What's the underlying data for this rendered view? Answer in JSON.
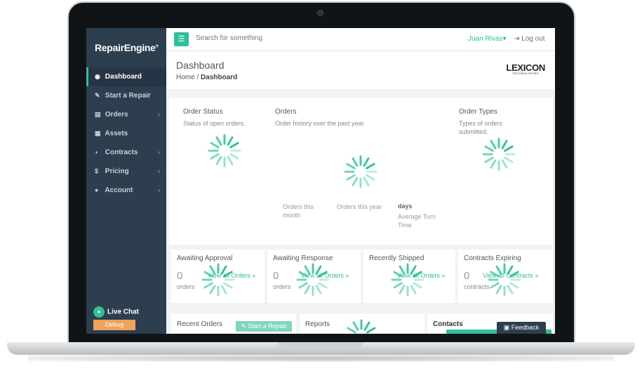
{
  "sidebar": {
    "brand": "RepairEngine",
    "brand_mark": "®",
    "items": [
      {
        "label": "Dashboard",
        "icon": "dashboard-icon",
        "glyph": "◉",
        "chevron": ""
      },
      {
        "label": "Start a Repair",
        "icon": "wrench-icon",
        "glyph": "✎",
        "chevron": ""
      },
      {
        "label": "Orders",
        "icon": "list-icon",
        "glyph": "▤",
        "chevron": "›"
      },
      {
        "label": "Assets",
        "icon": "grid-icon",
        "glyph": "▦",
        "chevron": ""
      },
      {
        "label": "Contracts",
        "icon": "shield-icon",
        "glyph": "◗",
        "chevron": "›"
      },
      {
        "label": "Pricing",
        "icon": "dollar-icon",
        "glyph": "$",
        "chevron": "›"
      },
      {
        "label": "Account",
        "icon": "user-icon",
        "glyph": "●",
        "chevron": "›"
      }
    ],
    "live_chat": "Live Chat",
    "debug": "Debug"
  },
  "topbar": {
    "search_placeholder": "Search for something",
    "user": "Juan Rivas",
    "user_caret": "▾",
    "logout": "Log out"
  },
  "header": {
    "title": "Dashboard",
    "breadcrumb_home": "Home",
    "breadcrumb_sep": "/",
    "breadcrumb_current": "Dashboard",
    "logo": "LEXICON",
    "logo_sub": "TECHNOLOGIES"
  },
  "panel": {
    "order_status": {
      "title": "Order Status",
      "subtitle": "Status of open orders."
    },
    "orders": {
      "title": "Orders",
      "subtitle": "Order history over the past year."
    },
    "order_types": {
      "title": "Order Types",
      "subtitle": "Types of orders submitted."
    },
    "stats": {
      "this_month": "Orders this month",
      "this_year": "Orders this year",
      "turn_value": "days",
      "turn_label": "Average Turn Time"
    }
  },
  "cards": [
    {
      "title": "Awaiting Approval",
      "count": "0",
      "unit": "orders",
      "link": "View all Orders »"
    },
    {
      "title": "Awaiting Response",
      "count": "0",
      "unit": "orders",
      "link": "View all Orders »"
    },
    {
      "title": "Recently Shipped",
      "count": "",
      "unit": "",
      "link": "View all Orders »"
    },
    {
      "title": "Contracts Expiring",
      "count": "0",
      "unit": "contracts",
      "link": "View all Contracts »"
    }
  ],
  "bottom": {
    "recent_orders": "Recent Orders",
    "start_repair": "Start a Repair",
    "reports": "Reports",
    "contacts": "Contacts",
    "feedback": "Feedback"
  },
  "colors": {
    "accent": "#2fbf9a",
    "sidebar": "#2d3e4f",
    "debug": "#f0a15a"
  }
}
